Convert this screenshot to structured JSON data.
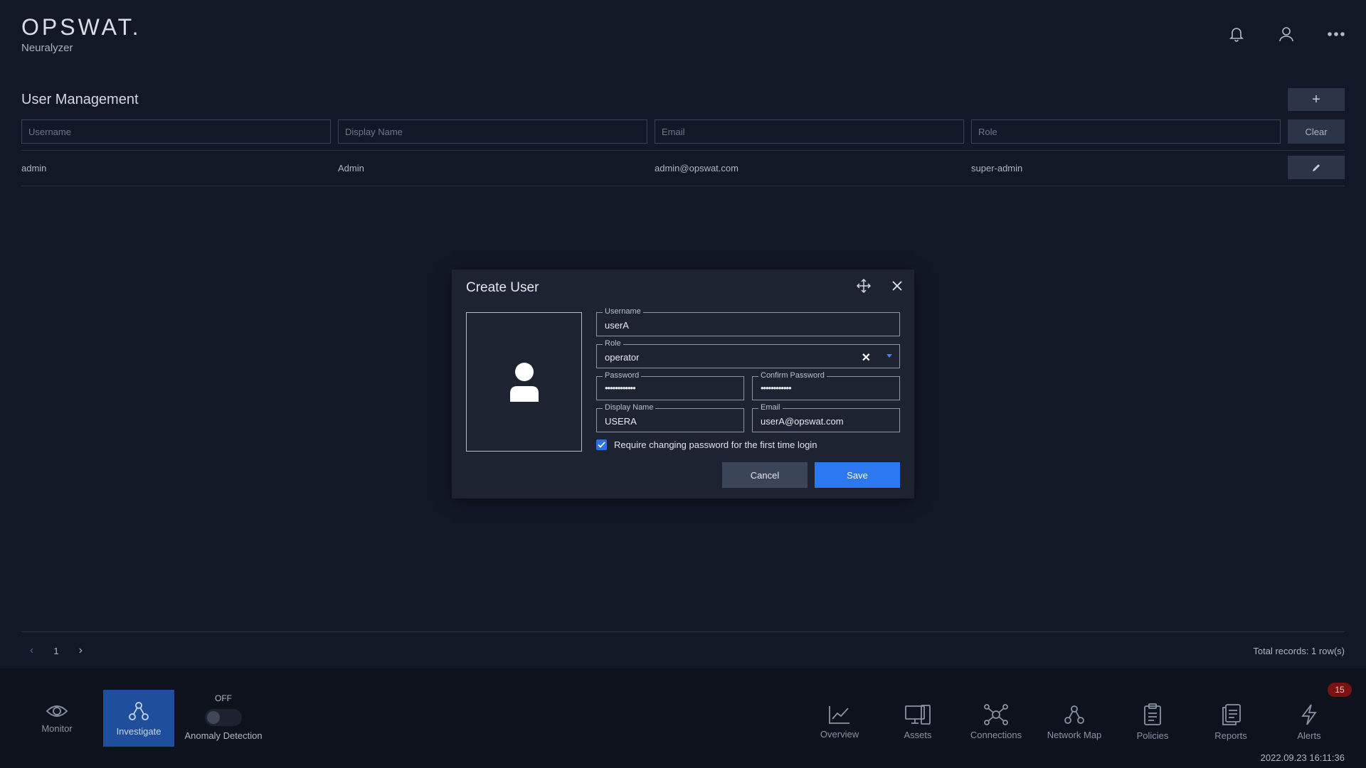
{
  "header": {
    "logo_text": "OPSWAT.",
    "product_name": "Neuralyzer",
    "icons": [
      "bell-icon",
      "user-icon",
      "more-icon"
    ]
  },
  "page": {
    "title": "User Management",
    "add_label": "+",
    "clear_label": "Clear",
    "filters": {
      "username_placeholder": "Username",
      "display_name_placeholder": "Display Name",
      "email_placeholder": "Email",
      "role_placeholder": "Role"
    },
    "rows": [
      {
        "username": "admin",
        "display_name": "Admin",
        "email": "admin@opswat.com",
        "role": "super-admin"
      }
    ]
  },
  "pager": {
    "prev": "‹",
    "page": "1",
    "next": "›",
    "total": "Total records: 1 row(s)"
  },
  "modal": {
    "title": "Create User",
    "username_label": "Username",
    "username_value": "userA",
    "role_label": "Role",
    "role_value": "operator",
    "role_clear": "✕",
    "password_label": "Password",
    "password_value": "••••••••••••",
    "confirm_label": "Confirm Password",
    "confirm_value": "••••••••••••",
    "display_name_label": "Display Name",
    "display_name_value": "USERA",
    "email_label": "Email",
    "email_value": "userA@opswat.com",
    "require_change_label": "Require changing password for the first time login",
    "require_change_checked": true,
    "cancel_label": "Cancel",
    "save_label": "Save"
  },
  "bottom_nav": {
    "left": [
      {
        "label": "Monitor",
        "icon": "eye-icon",
        "active": false
      },
      {
        "label": "Investigate",
        "icon": "investigate-icon",
        "active": true
      }
    ],
    "anomaly": {
      "state": "OFF",
      "label": "Anomaly Detection"
    },
    "right": [
      {
        "label": "Overview",
        "icon": "chart-icon"
      },
      {
        "label": "Assets",
        "icon": "assets-icon"
      },
      {
        "label": "Connections",
        "icon": "connections-icon"
      },
      {
        "label": "Network Map",
        "icon": "network-map-icon"
      },
      {
        "label": "Policies",
        "icon": "policies-icon"
      },
      {
        "label": "Reports",
        "icon": "reports-icon"
      },
      {
        "label": "Alerts",
        "icon": "alerts-icon"
      }
    ],
    "alerts_count": "15"
  },
  "status": {
    "timestamp": "2022.09.23 16:11:36"
  },
  "colors": {
    "background": "#121826",
    "accent": "#2b78f0",
    "active_nav": "#1f4f9c",
    "badge": "#7a1212"
  }
}
